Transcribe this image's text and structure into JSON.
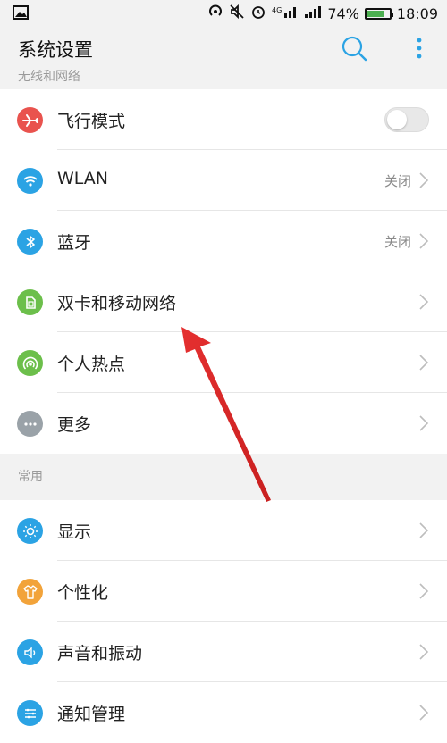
{
  "status": {
    "battery": "74%",
    "battery_level": 0.74,
    "time": "18:09"
  },
  "appbar": {
    "title": "系统设置",
    "search_icon": "search-icon",
    "more_icon": "more-vertical-icon"
  },
  "sections": {
    "wireless": {
      "header": "无线和网络"
    },
    "common": {
      "header": "常用"
    }
  },
  "wireless_items": [
    {
      "label": "飞行模式",
      "icon": "airplane-icon",
      "color": "#e9534e",
      "toggle": "off"
    },
    {
      "label": "WLAN",
      "icon": "wifi-icon",
      "color": "#2ba3e4",
      "value": "关闭"
    },
    {
      "label": "蓝牙",
      "icon": "bluetooth-icon",
      "color": "#2ba3e4",
      "value": "关闭"
    },
    {
      "label": "双卡和移动网络",
      "icon": "sim-card-icon",
      "color": "#6cbf4b"
    },
    {
      "label": "个人热点",
      "icon": "hotspot-icon",
      "color": "#6cbf4b"
    },
    {
      "label": "更多",
      "icon": "more-horizontal-icon",
      "color": "#9aa2a8"
    }
  ],
  "common_items": [
    {
      "label": "显示",
      "icon": "brightness-icon",
      "color": "#2ba3e4"
    },
    {
      "label": "个性化",
      "icon": "shirt-icon",
      "color": "#f2a33a"
    },
    {
      "label": "声音和振动",
      "icon": "speaker-icon",
      "color": "#2ba3e4"
    },
    {
      "label": "通知管理",
      "icon": "notification-settings-icon",
      "color": "#2ba3e4"
    }
  ],
  "colors": {
    "accent": "#2ba3e4",
    "annotation_arrow": "#e53030",
    "battery": "#4caf50"
  }
}
